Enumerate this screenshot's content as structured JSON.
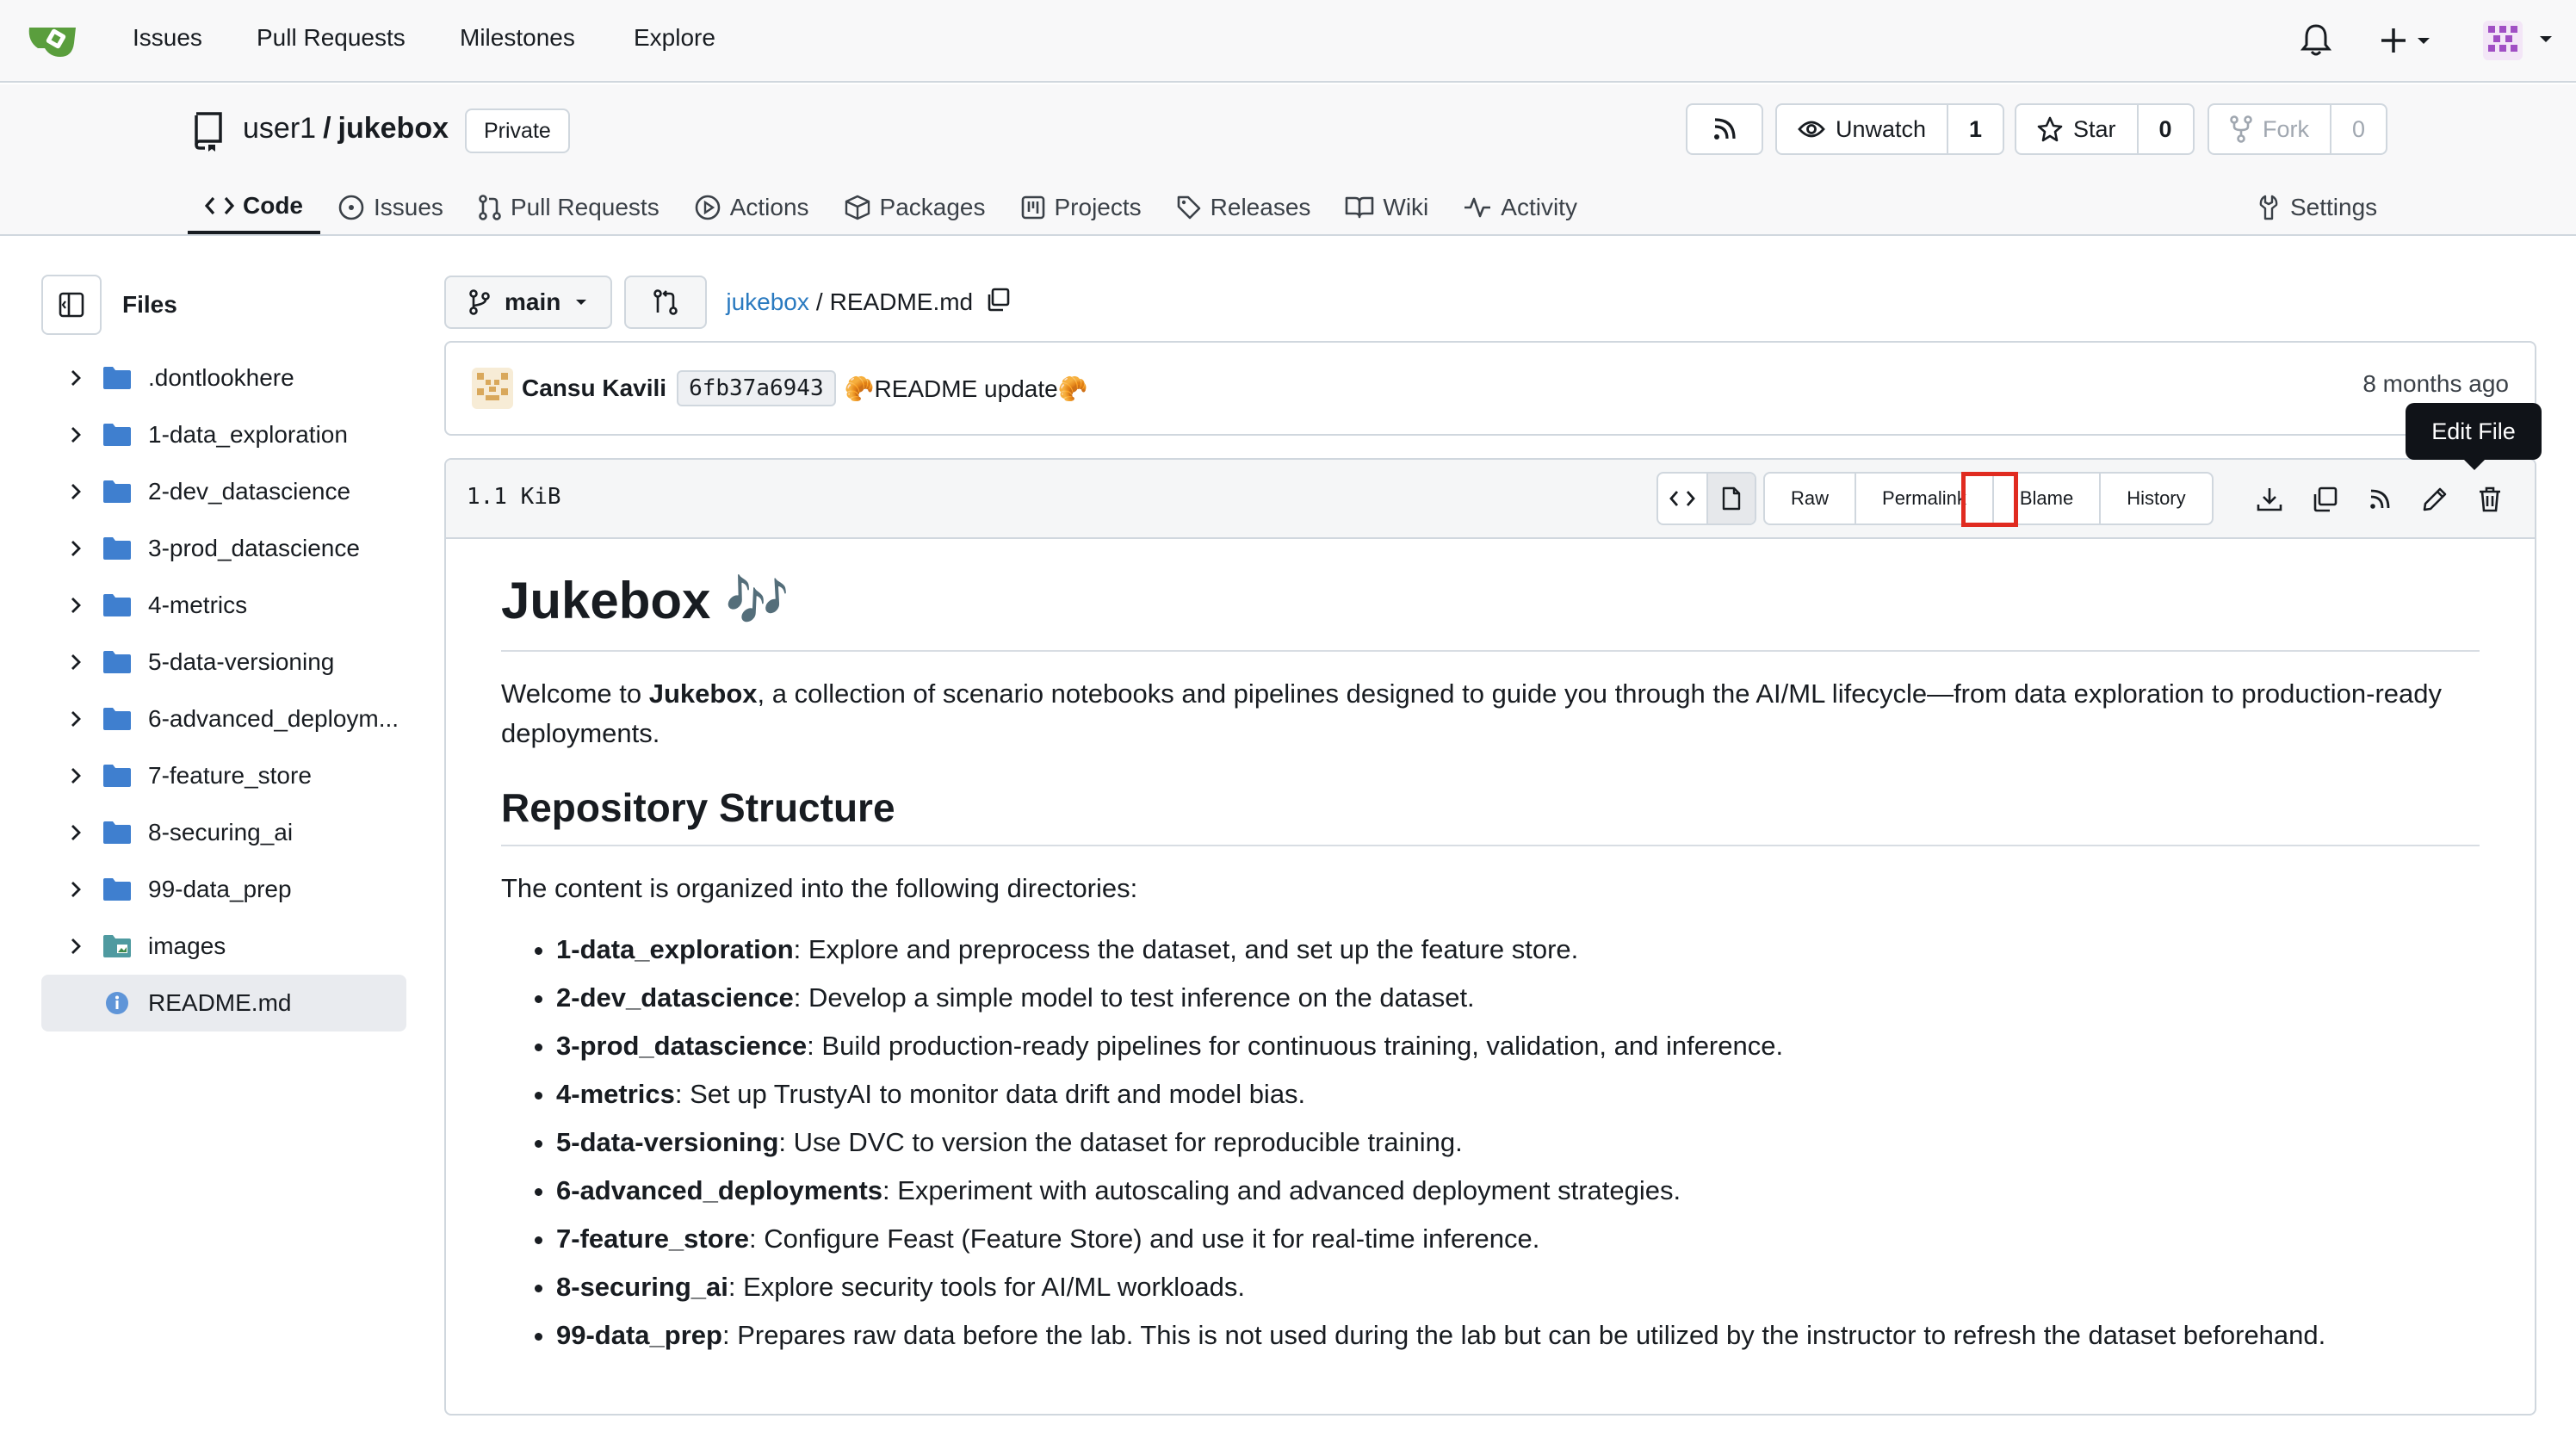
{
  "nav": {
    "links": [
      "Issues",
      "Pull Requests",
      "Milestones",
      "Explore"
    ]
  },
  "repo": {
    "owner": "user1",
    "separator": "/",
    "name": "jukebox",
    "visibility": "Private",
    "unwatch_label": "Unwatch",
    "watch_count": "1",
    "star_label": "Star",
    "star_count": "0",
    "fork_label": "Fork",
    "fork_count": "0"
  },
  "tabs": [
    {
      "label": "Code",
      "icon": "code-icon"
    },
    {
      "label": "Issues",
      "icon": "issue-icon"
    },
    {
      "label": "Pull Requests",
      "icon": "pull-request-icon"
    },
    {
      "label": "Actions",
      "icon": "play-icon"
    },
    {
      "label": "Packages",
      "icon": "package-icon"
    },
    {
      "label": "Projects",
      "icon": "project-icon"
    },
    {
      "label": "Releases",
      "icon": "tag-icon"
    },
    {
      "label": "Wiki",
      "icon": "book-icon"
    },
    {
      "label": "Activity",
      "icon": "pulse-icon"
    }
  ],
  "settings_label": "Settings",
  "sidebar": {
    "title": "Files",
    "items": [
      {
        "label": ".dontlookhere",
        "type": "folder"
      },
      {
        "label": "1-data_exploration",
        "type": "folder"
      },
      {
        "label": "2-dev_datascience",
        "type": "folder"
      },
      {
        "label": "3-prod_datascience",
        "type": "folder"
      },
      {
        "label": "4-metrics",
        "type": "folder"
      },
      {
        "label": "5-data-versioning",
        "type": "folder"
      },
      {
        "label": "6-advanced_deploym...",
        "type": "folder"
      },
      {
        "label": "7-feature_store",
        "type": "folder"
      },
      {
        "label": "8-securing_ai",
        "type": "folder"
      },
      {
        "label": "99-data_prep",
        "type": "folder"
      },
      {
        "label": "images",
        "type": "image-folder"
      },
      {
        "label": "README.md",
        "type": "file"
      }
    ]
  },
  "breadcrumb": {
    "branch": "main",
    "repo_link": "jukebox",
    "separator": "/",
    "file": "README.md"
  },
  "commit": {
    "author": "Cansu Kavili",
    "sha": "6fb37a6943",
    "message": "🥐README update🥐",
    "time": "8 months ago"
  },
  "file": {
    "size": "1.1 KiB",
    "actions": [
      "Raw",
      "Permalink",
      "Blame",
      "History"
    ],
    "tooltip": "Edit File"
  },
  "readme": {
    "title": "Jukebox 🎶",
    "intro_pre": "Welcome to ",
    "intro_bold": "Jukebox",
    "intro_post": ", a collection of scenario notebooks and pipelines designed to guide you through the AI/ML lifecycle—from data exploration to production-ready deployments.",
    "h2": "Repository Structure",
    "para": "The content is organized into the following directories:",
    "items": [
      {
        "name": "1-data_exploration",
        "desc": ": Explore and preprocess the dataset, and set up the feature store."
      },
      {
        "name": "2-dev_datascience",
        "desc": ": Develop a simple model to test inference on the dataset."
      },
      {
        "name": "3-prod_datascience",
        "desc": ": Build production-ready pipelines for continuous training, validation, and inference."
      },
      {
        "name": "4-metrics",
        "desc": ": Set up TrustyAI to monitor data drift and model bias."
      },
      {
        "name": "5-data-versioning",
        "desc": ": Use DVC to version the dataset for reproducible training."
      },
      {
        "name": "6-advanced_deployments",
        "desc": ": Experiment with autoscaling and advanced deployment strategies."
      },
      {
        "name": "7-feature_store",
        "desc": ": Configure Feast (Feature Store) and use it for real-time inference."
      },
      {
        "name": "8-securing_ai",
        "desc": ": Explore security tools for AI/ML workloads."
      },
      {
        "name": "99-data_prep",
        "desc": ": Prepares raw data before the lab. This is not used during the lab but can be utilized by the instructor to refresh the dataset beforehand."
      }
    ]
  },
  "colors": {
    "accent_link": "#2a7ac0",
    "folder": "#3f7fcf",
    "highlight": "#e02b20",
    "logo": "#5a9e3d"
  }
}
